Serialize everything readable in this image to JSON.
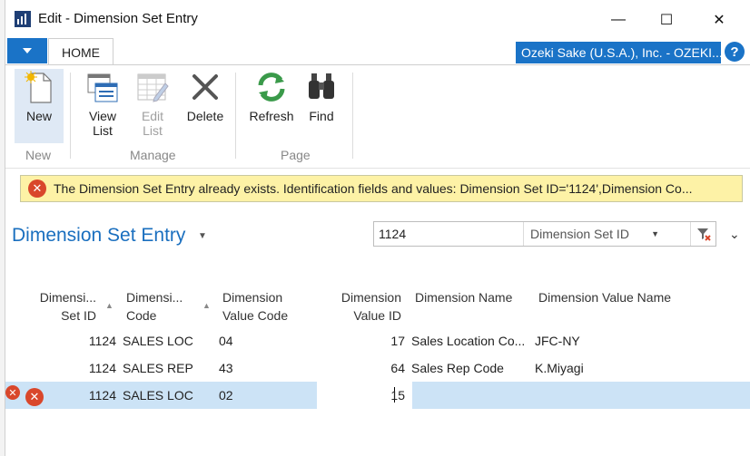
{
  "window": {
    "title": "Edit - Dimension Set Entry",
    "minimize_glyph": "—",
    "maximize_glyph": "☐",
    "close_glyph": "✕"
  },
  "ribbon": {
    "tab_home": "HOME",
    "company": "Ozeki Sake (U.S.A.), Inc. - OZEKI...",
    "help_glyph": "?",
    "groups": {
      "new": "New",
      "manage": "Manage",
      "page": "Page"
    },
    "buttons": {
      "new": "New",
      "view_list_1": "View",
      "view_list_2": "List",
      "edit_list_1": "Edit",
      "edit_list_2": "List",
      "delete": "Delete",
      "refresh": "Refresh",
      "find": "Find"
    }
  },
  "error": {
    "message": "The Dimension Set Entry already exists. Identification fields and values: Dimension Set ID='1124',Dimension Co..."
  },
  "page": {
    "title": "Dimension Set Entry"
  },
  "filter": {
    "value": "1124",
    "field": "Dimension Set ID"
  },
  "columns": {
    "set_id_1": "Dimensi...",
    "set_id_2": "Set ID",
    "code_1": "Dimensi...",
    "code_2": "Code",
    "value_code_1": "Dimension",
    "value_code_2": "Value Code",
    "value_id_1": "Dimension",
    "value_id_2": "Value ID",
    "dim_name": "Dimension Name",
    "dim_value_name": "Dimension Value Name"
  },
  "rows": [
    {
      "set_id": "1124",
      "code": "SALES LOC",
      "value_code": "04",
      "value_id": "17",
      "name": "Sales Location Co...",
      "value_name": "JFC-NY"
    },
    {
      "set_id": "1124",
      "code": "SALES REP",
      "value_code": "43",
      "value_id": "64",
      "name": "Sales Rep Code",
      "value_name": "K.Miyagi"
    },
    {
      "set_id": "1124",
      "code": "SALES LOC",
      "value_code": "02",
      "value_id": "15",
      "name": "",
      "value_name": ""
    }
  ],
  "colors": {
    "accent": "#1a73c7",
    "title_blue": "#1a6fbf",
    "error_bg": "#fdf2a6",
    "error_red": "#d9472b",
    "selected_row": "#cce3f6"
  }
}
